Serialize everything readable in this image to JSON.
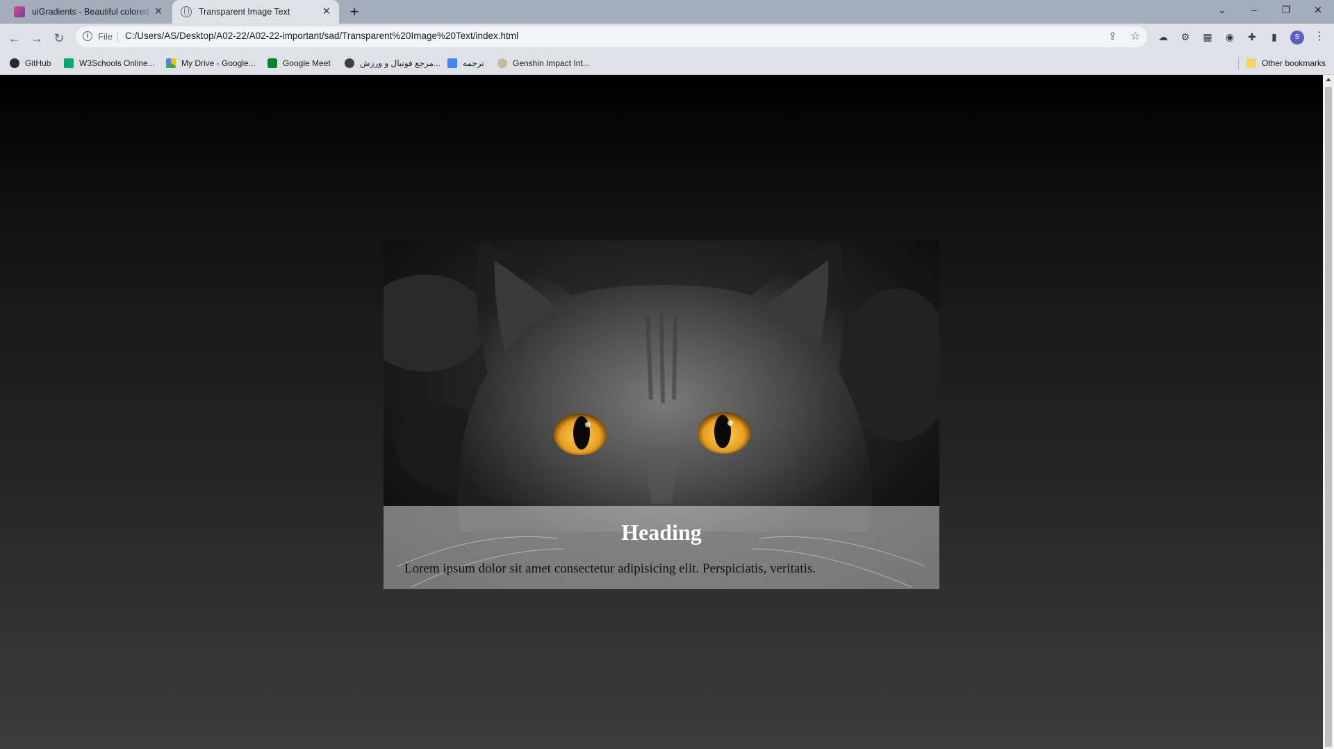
{
  "browser": {
    "tabs": [
      {
        "title": "uiGradients - Beautiful colored gradients",
        "icon": "uigradients-favicon",
        "active": false
      },
      {
        "title": "Transparent Image Text",
        "icon": "globe-icon",
        "active": true
      }
    ],
    "new_tab_label": "+",
    "window_controls": {
      "minimize": "–",
      "restore": "❐",
      "close": "✕",
      "tab_search": "⌄"
    },
    "address": {
      "scheme_label": "File",
      "url": "C:/Users/AS/Desktop/A02-22/A02-22-important/sad/Transparent%20Image%20Text/index.html"
    },
    "profile_initial": "S",
    "bookmarks": [
      {
        "label": "GitHub",
        "icon": "github-icon",
        "color": "#24292f"
      },
      {
        "label": "W3Schools Online...",
        "icon": "w3schools-icon",
        "color": "#04aa6d"
      },
      {
        "label": "My Drive - Google...",
        "icon": "google-drive-icon",
        "color": "#fbbc04"
      },
      {
        "label": "Google Meet",
        "icon": "google-meet-icon",
        "color": "#00832d"
      },
      {
        "label": "مرجع فوتبال و ورزش...",
        "icon": "football-icon",
        "color": "#3c4043"
      },
      {
        "label": "ترجمه",
        "icon": "google-translate-icon",
        "color": "#4285f4"
      },
      {
        "label": "Genshin Impact Int...",
        "icon": "genshin-icon",
        "color": "#c8b8a0"
      }
    ],
    "other_bookmarks": "Other bookmarks"
  },
  "page": {
    "card": {
      "heading": "Heading",
      "text": "Lorem ipsum dolor sit amet consectetur adipisicing elit. Perspiciatis, veritatis.",
      "image_subject": "gray cat with orange eyes"
    },
    "eye_color": "#e8a020",
    "background_gradient": [
      "#000000",
      "#3c3c3c"
    ]
  }
}
